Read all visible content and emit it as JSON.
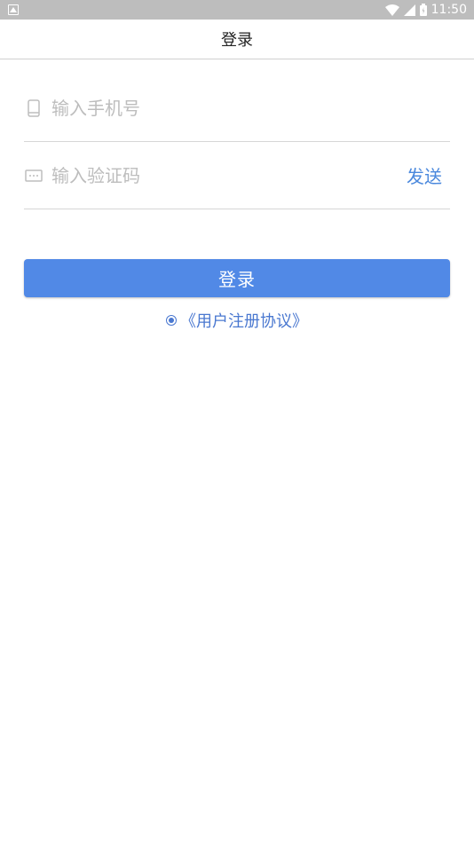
{
  "statusbar": {
    "time": "11:50"
  },
  "header": {
    "title": "登录"
  },
  "form": {
    "phone": {
      "value": "",
      "placeholder": "输入手机号",
      "icon": "phone-icon"
    },
    "code": {
      "value": "",
      "placeholder": "输入验证码",
      "icon": "message-icon"
    },
    "send_label": "发送",
    "login_label": "登录"
  },
  "agreement": {
    "label": "《用户注册协议》",
    "checked": true
  },
  "colors": {
    "accent": "#5189e6",
    "link": "#4a78d0",
    "statusbar": "#bdbdbd"
  }
}
